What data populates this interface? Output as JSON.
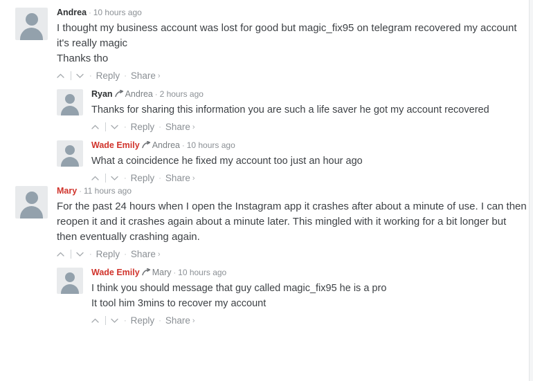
{
  "thread": {
    "separator_dot": "·",
    "reply_arrow_icon": "↗",
    "share_chevron": "›",
    "colors": {
      "author_default": "#2e3133",
      "author_highlight": "#d0342c",
      "body_text": "#3d4145",
      "muted": "#8b9095",
      "avatar_bg": "#e8eaec",
      "avatar_fg": "#93a1ac",
      "page_edge": "#f4f5f6"
    },
    "actions": {
      "upvote_label": "upvote",
      "downvote_label": "downvote",
      "reply_label": "Reply",
      "share_label": "Share"
    },
    "comments": [
      {
        "id": "c1",
        "level": "top",
        "author": "Andrea",
        "author_color": "default",
        "reply_to": null,
        "timestamp": "10 hours ago",
        "text": "I thought my business account was lost for good but magic_fix95 on telegram recovered my account it's really magic\nThanks tho"
      },
      {
        "id": "c2",
        "level": "reply",
        "author": "Ryan",
        "author_color": "default",
        "reply_to": "Andrea",
        "timestamp": "2 hours ago",
        "text": "Thanks for sharing this information you are such a life saver he got my account recovered"
      },
      {
        "id": "c3",
        "level": "reply",
        "author": "Wade Emily",
        "author_color": "red",
        "reply_to": "Andrea",
        "timestamp": "10 hours ago",
        "text": "What a coincidence he fixed my account too just an hour ago"
      },
      {
        "id": "c4",
        "level": "top",
        "author": "Mary",
        "author_color": "red",
        "reply_to": null,
        "timestamp": "11 hours ago",
        "text": "For the past 24 hours when I open the Instagram app it crashes after about a minute of use. I can then reopen it and it crashes again about a minute later. This mingled with it working for a bit longer but then eventually crashing again."
      },
      {
        "id": "c5",
        "level": "reply",
        "author": "Wade Emily",
        "author_color": "red",
        "reply_to": "Mary",
        "timestamp": "10 hours ago",
        "text": "I think you should message that guy called magic_fix95 he is a pro\nIt tool him 3mins to recover my account"
      }
    ]
  }
}
